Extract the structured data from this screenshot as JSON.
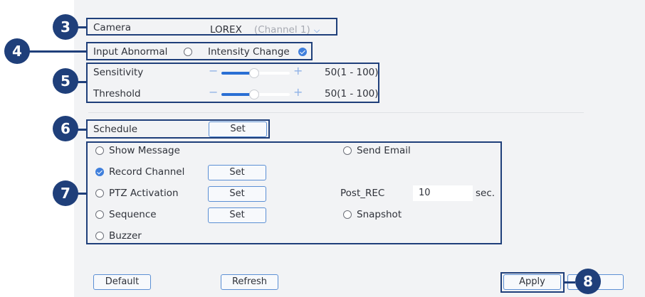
{
  "camera": {
    "label": "Camera",
    "value": "LOREX",
    "channel": "(Channel 1)"
  },
  "input_abnormal": {
    "label": "Input Abnormal",
    "intensity_label": "Intensity Change"
  },
  "sensitivity": {
    "label": "Sensitivity",
    "value_text": "50(1 - 100)",
    "value": 50
  },
  "threshold": {
    "label": "Threshold",
    "value_text": "50(1 - 100)",
    "value": 50
  },
  "schedule": {
    "label": "Schedule",
    "button": "Set"
  },
  "actions": {
    "show_message": "Show Message",
    "send_email": "Send Email",
    "record_channel": "Record Channel",
    "record_set": "Set",
    "ptz_activation": "PTZ Activation",
    "ptz_set": "Set",
    "post_rec_label": "Post_REC",
    "post_rec_value": "10",
    "post_rec_unit": "sec.",
    "sequence": "Sequence",
    "sequence_set": "Set",
    "snapshot": "Snapshot",
    "buzzer": "Buzzer"
  },
  "footer": {
    "default": "Default",
    "refresh": "Refresh",
    "apply": "Apply"
  },
  "callouts": [
    "3",
    "4",
    "5",
    "6",
    "7",
    "8"
  ],
  "colors": {
    "accent": "#3f7fdc",
    "callout": "#1f3f7a",
    "panel": "#f2f3f5"
  }
}
